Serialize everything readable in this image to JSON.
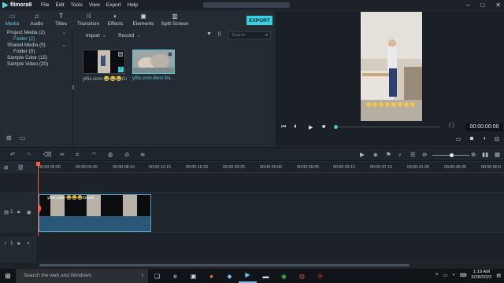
{
  "app": {
    "logo": "filmora9",
    "menu": [
      "File",
      "Edit",
      "Tools",
      "View",
      "Export",
      "Help"
    ],
    "window_controls": [
      "–",
      "□",
      "✕"
    ]
  },
  "tabs": [
    {
      "label": "Media",
      "icon": "folder-icon"
    },
    {
      "label": "Audio",
      "icon": "music-note-icon"
    },
    {
      "label": "Titles",
      "icon": "text-icon"
    },
    {
      "label": "Transition",
      "icon": "transition-icon"
    },
    {
      "label": "Effects",
      "icon": "effects-icon"
    },
    {
      "label": "Elements",
      "icon": "elements-icon"
    },
    {
      "label": "Split Screen",
      "icon": "split-screen-icon"
    }
  ],
  "export_label": "EXPORT",
  "tree": [
    {
      "label": "Project Media (2)"
    },
    {
      "label": "Folder (2)"
    },
    {
      "label": "Shared Media (0)"
    },
    {
      "label": "Folder (0)"
    },
    {
      "label": "Sample Color (15)"
    },
    {
      "label": "Sample Video (20)"
    }
  ],
  "media_bar": {
    "import_label": "Import",
    "record_label": "Record",
    "search_placeholder": "Search"
  },
  "clips": [
    {
      "label": "yt5s.com-😂😂😂Good..."
    },
    {
      "label": "yt5s.com-Best Ba..."
    }
  ],
  "preview": {
    "timecode": "00:00:00:00",
    "brackets": "{ }"
  },
  "ruler_ticks": [
    "00:00:00:00",
    "00:00:04:05",
    "00:00:08:10",
    "00:00:12:15",
    "00:00:16:20",
    "00:00:20:25",
    "00:00:25:00",
    "00:00:29:05",
    "00:00:33:10",
    "00:00:37:15",
    "00:00:41:20",
    "00:00:45:25",
    "00:00:50:0"
  ],
  "timeline": {
    "video_clip_name": "yt5s.com-😂😂😂Good ...",
    "video_track_num": "1",
    "audio_track_num": "1"
  },
  "taskbar": {
    "search_placeholder": "Search the web and Windows",
    "time": "1:19 AM",
    "date": "5/28/2022"
  }
}
